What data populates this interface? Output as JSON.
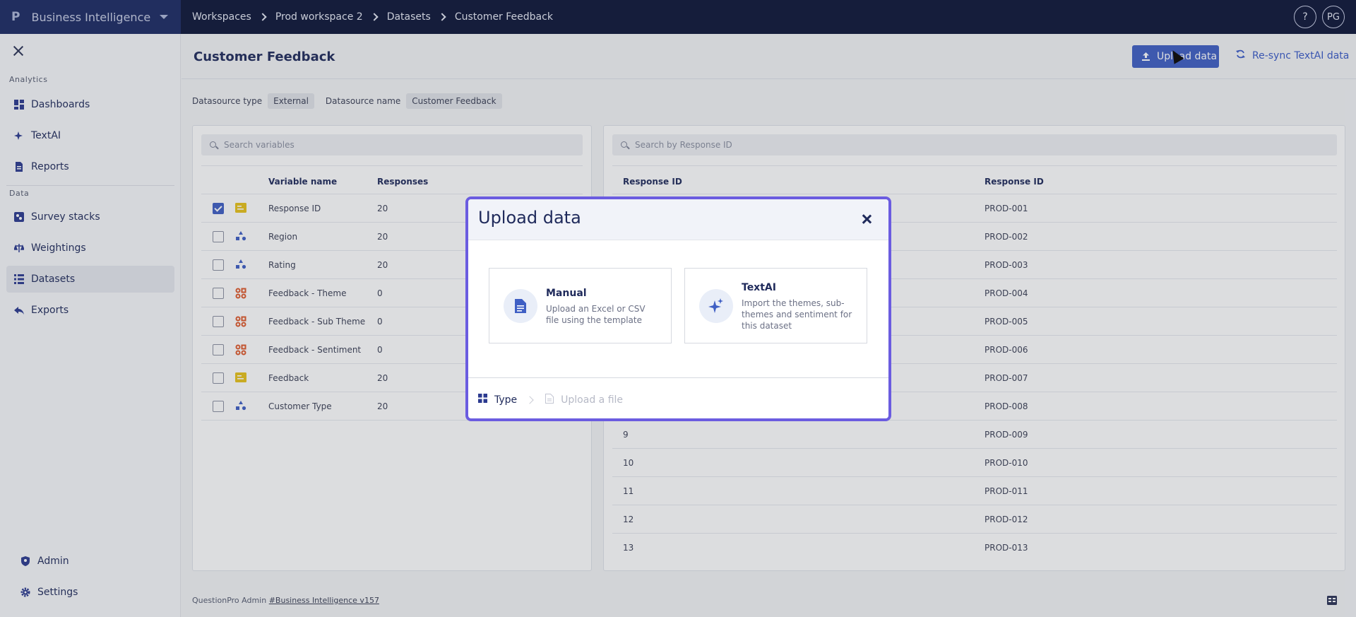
{
  "topbar": {
    "logo": "P",
    "app_name": "Business Intelligence",
    "breadcrumbs": [
      "Workspaces",
      "Prod workspace 2",
      "Datasets",
      "Customer Feedback"
    ],
    "help_label": "?",
    "user_initials": "PG"
  },
  "sidebar": {
    "analytics_label": "Analytics",
    "data_label": "Data",
    "items": [
      {
        "label": "Dashboards",
        "icon": "dashboard-icon"
      },
      {
        "label": "TextAI",
        "icon": "sparkle-icon"
      },
      {
        "label": "Reports",
        "icon": "report-icon"
      },
      {
        "label": "Survey stacks",
        "icon": "survey-stacks-icon"
      },
      {
        "label": "Weightings",
        "icon": "weightings-icon"
      },
      {
        "label": "Datasets",
        "icon": "datasets-icon",
        "active": true
      },
      {
        "label": "Exports",
        "icon": "export-icon"
      }
    ],
    "admin_label": "Admin",
    "settings_label": "Settings"
  },
  "main": {
    "title": "Customer Feedback",
    "upload_label": "Upload data",
    "resync_label": "Re-sync TextAI data",
    "datasource_type_label": "Datasource type",
    "datasource_type_value": "External",
    "datasource_name_label": "Datasource name",
    "datasource_name_value": "Customer Feedback",
    "variables": {
      "search_placeholder": "Search variables",
      "col_name": "Variable name",
      "col_responses": "Responses",
      "rows": [
        {
          "name": "Response ID",
          "responses": "20",
          "checked": true,
          "type": "text"
        },
        {
          "name": "Region",
          "responses": "20",
          "checked": false,
          "type": "categorical"
        },
        {
          "name": "Rating",
          "responses": "20",
          "checked": false,
          "type": "categorical"
        },
        {
          "name": "Feedback - Theme",
          "responses": "0",
          "checked": false,
          "type": "multi"
        },
        {
          "name": "Feedback - Sub Theme",
          "responses": "0",
          "checked": false,
          "type": "multi"
        },
        {
          "name": "Feedback - Sentiment",
          "responses": "0",
          "checked": false,
          "type": "multi"
        },
        {
          "name": "Feedback",
          "responses": "20",
          "checked": false,
          "type": "text"
        },
        {
          "name": "Customer Type",
          "responses": "20",
          "checked": false,
          "type": "categorical"
        }
      ]
    },
    "responses": {
      "search_placeholder": "Search by Response ID",
      "col_a": "Response ID",
      "col_b": "Response ID",
      "rows": [
        {
          "a": "",
          "b": "PROD-001"
        },
        {
          "a": "",
          "b": "PROD-002"
        },
        {
          "a": "",
          "b": "PROD-003"
        },
        {
          "a": "",
          "b": "PROD-004"
        },
        {
          "a": "",
          "b": "PROD-005"
        },
        {
          "a": "",
          "b": "PROD-006"
        },
        {
          "a": "",
          "b": "PROD-007"
        },
        {
          "a": "",
          "b": "PROD-008"
        },
        {
          "a": "9",
          "b": "PROD-009"
        },
        {
          "a": "10",
          "b": "PROD-010"
        },
        {
          "a": "11",
          "b": "PROD-011"
        },
        {
          "a": "12",
          "b": "PROD-012"
        },
        {
          "a": "13",
          "b": "PROD-013"
        }
      ]
    },
    "footer_text": "QuestionPro Admin",
    "footer_link": "#Business Intelligence v157"
  },
  "modal": {
    "title": "Upload data",
    "manual_title": "Manual",
    "manual_desc": "Upload an Excel or CSV file using the template",
    "textai_title": "TextAI",
    "textai_desc": "Import the themes, sub-themes and sentiment for this dataset",
    "step1": "Type",
    "step2": "Upload a file"
  },
  "colors": {
    "topbar": "#0d1537",
    "brand": "#1c2a63",
    "primary": "#3f5fc4",
    "modal_border": "#6b5ce0",
    "text_type_icon": "#e8c21a",
    "cat_type_icon": "#3f5fc4",
    "multi_type_icon": "#e05a2b"
  }
}
